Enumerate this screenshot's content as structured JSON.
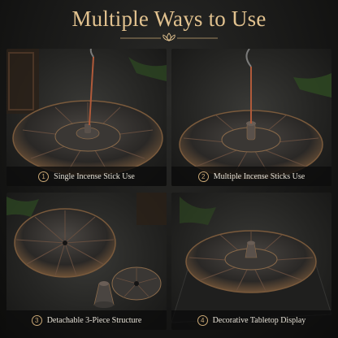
{
  "header": {
    "title": "Multiple Ways to Use",
    "ornament_icon": "lotus-icon"
  },
  "colors": {
    "accent_gold": "#e2c28f",
    "caption_text": "#e6e1d6",
    "background": "#141413",
    "bronze": "#8a6a4a"
  },
  "panels": [
    {
      "number": "1",
      "caption": "Single Incense Stick Use"
    },
    {
      "number": "2",
      "caption": "Multiple Incense Sticks Use"
    },
    {
      "number": "3",
      "caption": "Detachable 3-Piece Structure"
    },
    {
      "number": "4",
      "caption": "Decorative Tabletop Display"
    }
  ]
}
